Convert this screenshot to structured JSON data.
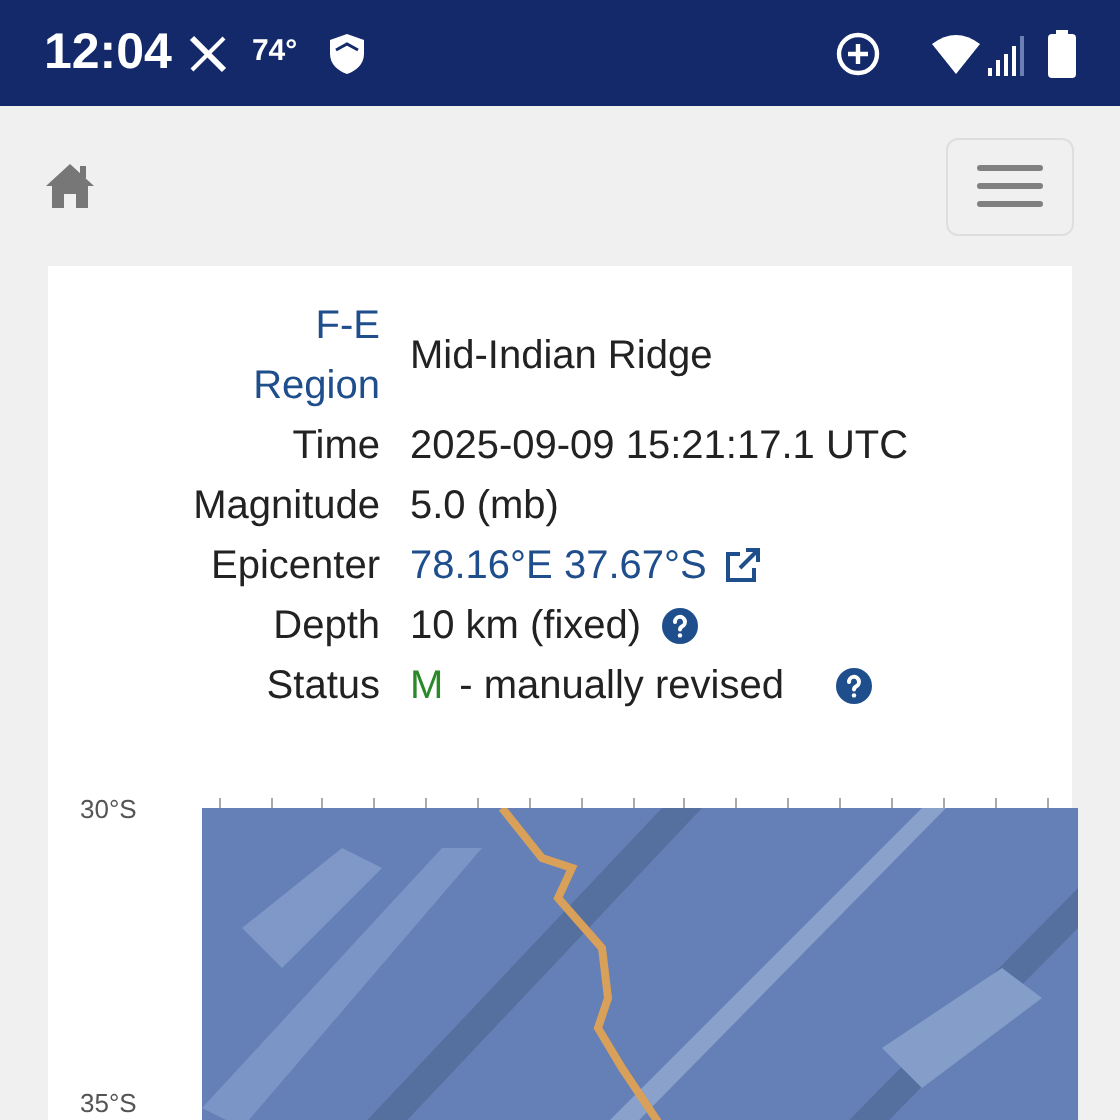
{
  "status_bar": {
    "time": "12:04",
    "temperature": "74°"
  },
  "details": [
    {
      "label": "F-E Region",
      "label_link": true,
      "value": "Mid-Indian Ridge",
      "kind": "text",
      "help": false
    },
    {
      "label": "Time",
      "label_link": false,
      "value": "2025-09-09 15:21:17.1 UTC",
      "kind": "text",
      "help": false
    },
    {
      "label": "Magnitude",
      "label_link": false,
      "value": "5.0 (mb)",
      "kind": "text",
      "help": false
    },
    {
      "label": "Epicenter",
      "label_link": false,
      "value": "78.16°E 37.67°S",
      "kind": "link",
      "help": false
    },
    {
      "label": "Depth",
      "label_link": false,
      "value": "10 km (fixed)",
      "kind": "text",
      "help": true
    },
    {
      "label": "Status",
      "label_link": false,
      "code": "M",
      "value": "- manually revised",
      "kind": "status",
      "help": true
    }
  ],
  "map": {
    "kind": "picture",
    "lat_labels": [
      "30°S",
      "35°S"
    ]
  }
}
